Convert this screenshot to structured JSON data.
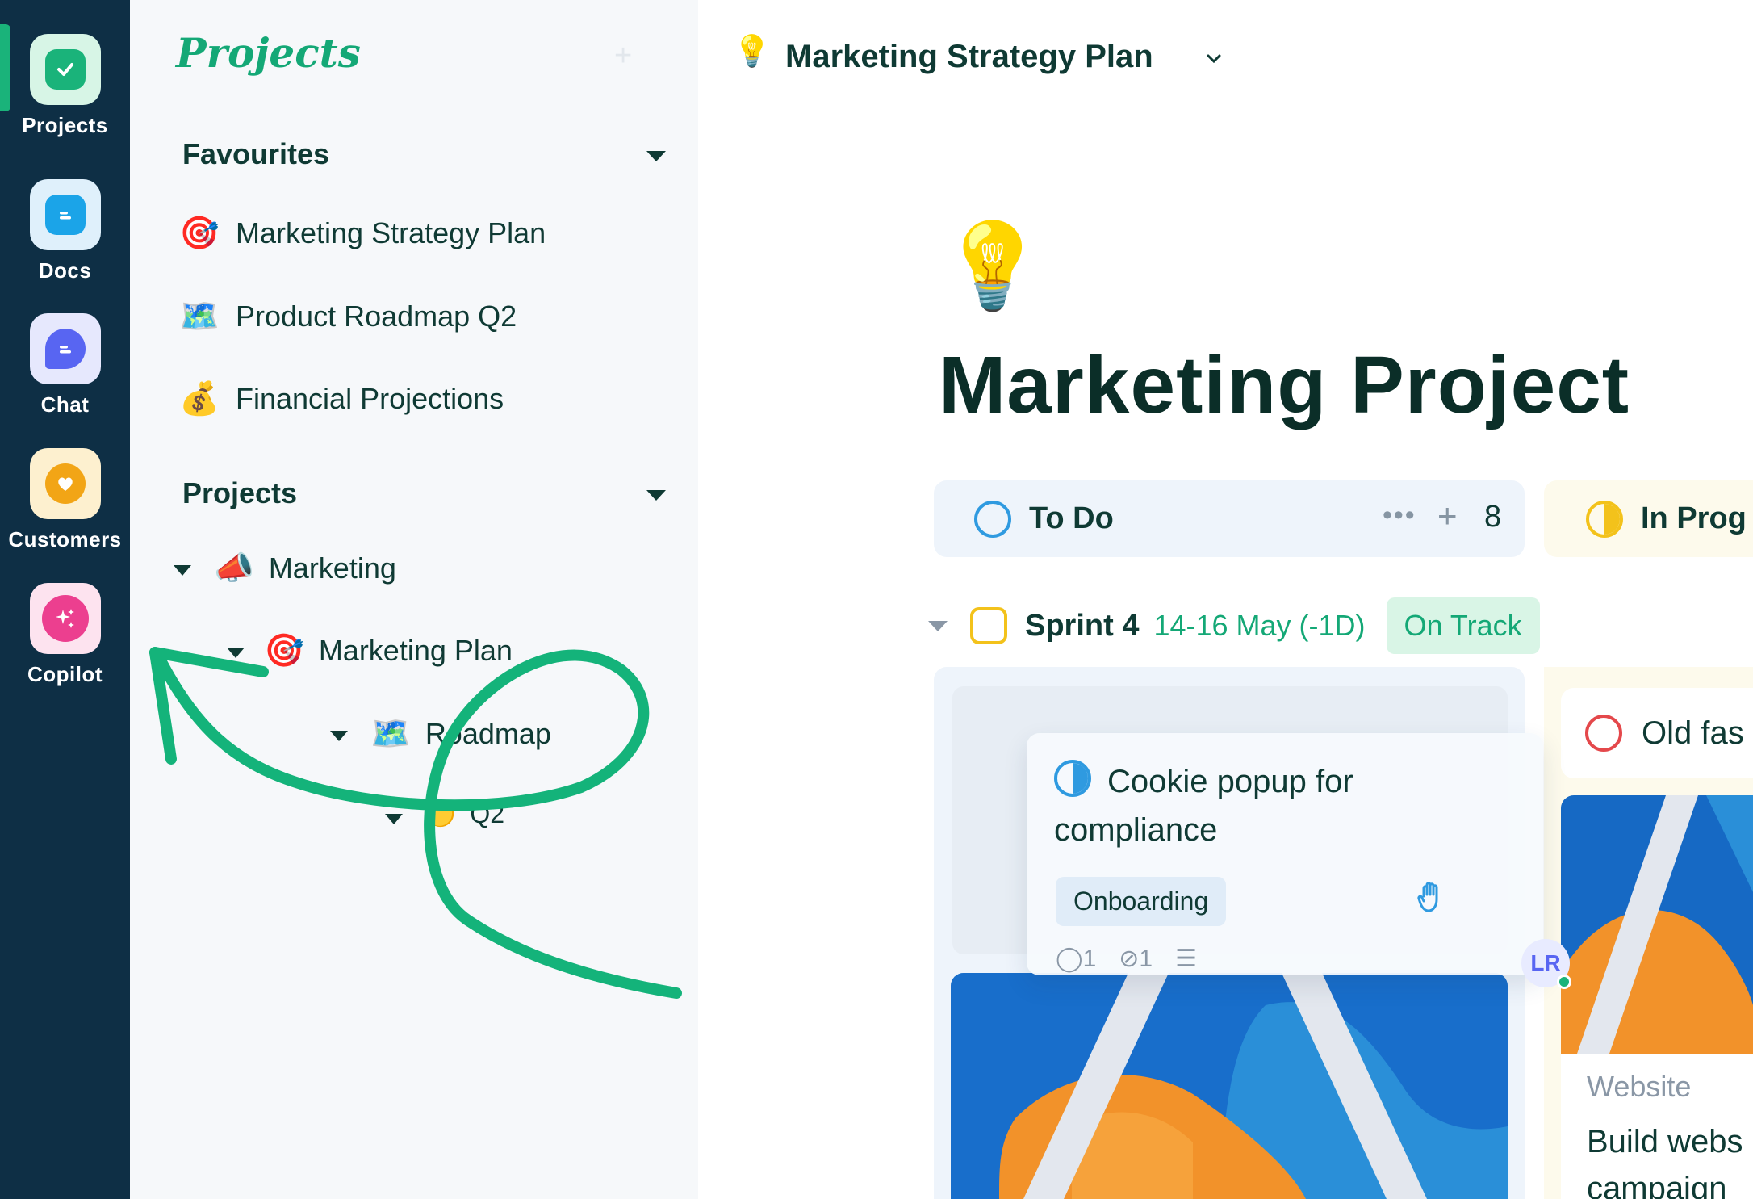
{
  "rail": {
    "items": [
      {
        "label": "Projects",
        "icon": "check-icon",
        "tile": "#d7f5e6",
        "inner": "#1ab37a"
      },
      {
        "label": "Docs",
        "icon": "doc-icon",
        "tile": "#dff0fb",
        "inner": "#1ba4e8"
      },
      {
        "label": "Chat",
        "icon": "chat-bubble-icon",
        "tile": "#e6e8fd",
        "inner": "#5865f2"
      },
      {
        "label": "Customers",
        "icon": "heart-icon",
        "tile": "#fdf0cf",
        "inner": "#f2a516"
      },
      {
        "label": "Copilot",
        "icon": "sparkle-icon",
        "tile": "#fde3ef",
        "inner": "#ec3f8f"
      }
    ]
  },
  "panel": {
    "title": "Projects",
    "favourites_heading": "Favourites",
    "favourites": [
      {
        "emoji": "🎯",
        "label": "Marketing Strategy Plan"
      },
      {
        "emoji": "🗺️",
        "label": "Product Roadmap Q2"
      },
      {
        "emoji": "💰",
        "label": "Financial Projections"
      }
    ],
    "projects_heading": "Projects",
    "tree": [
      {
        "emoji": "📣",
        "label": "Marketing"
      },
      {
        "emoji": "🎯",
        "label": "Marketing Plan"
      },
      {
        "emoji": "🗺️",
        "label": "Roadmap"
      },
      {
        "emoji": "🟡",
        "label": "Q2"
      }
    ]
  },
  "topbar": {
    "emoji": "💡",
    "title": "Marketing Strategy Plan"
  },
  "hero": {
    "emoji": "💡",
    "title": "Marketing Project"
  },
  "columns": {
    "todo": {
      "label": "To Do",
      "count": "8",
      "dots": "•••",
      "plus": "+"
    },
    "progress": {
      "label": "In Prog"
    }
  },
  "sprint": {
    "name": "Sprint 4",
    "dates": "14-16 May (-1D)",
    "badge": "On Track"
  },
  "drag_card": {
    "title": "Cookie popup for compliance",
    "tag": "Onboarding",
    "comments": "1",
    "attachments": "1"
  },
  "avatar": {
    "initials": "LR"
  },
  "right_cards": {
    "old_card": "Old fas",
    "web_label": "Website",
    "web_title_1": "Build webs",
    "web_title_2": "campaign"
  },
  "colors": {
    "rail_bg": "#0e2f45",
    "accent_green": "#14a876",
    "todo_circle": "#2f9ae0",
    "progress_circle": "#f3c21b",
    "danger": "#e4484b"
  }
}
